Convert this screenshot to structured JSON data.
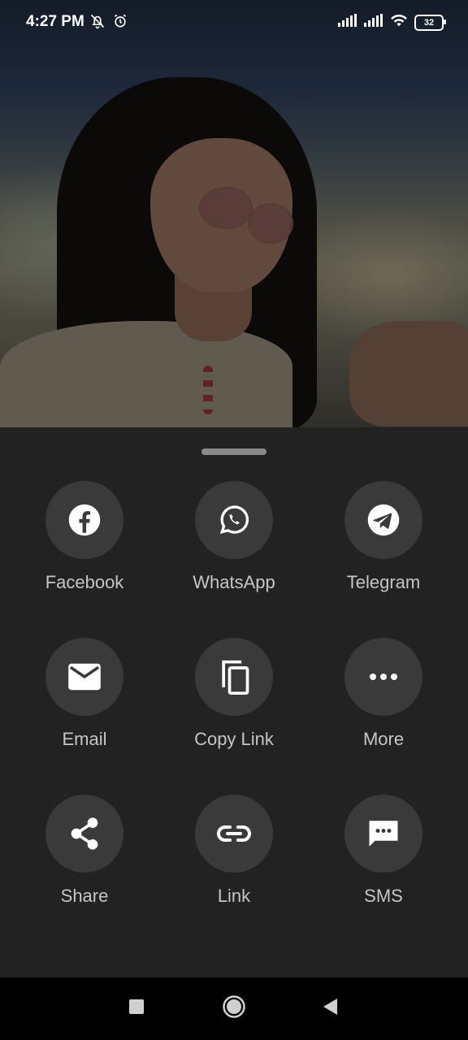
{
  "status_bar": {
    "time": "4:27 PM",
    "battery": "32",
    "icons": [
      "notifications-off-icon",
      "alarm-icon",
      "signal-icon",
      "signal-icon",
      "wifi-icon",
      "battery-icon"
    ]
  },
  "share_sheet": {
    "items": [
      {
        "label": "Facebook",
        "icon": "facebook-icon"
      },
      {
        "label": "WhatsApp",
        "icon": "whatsapp-icon"
      },
      {
        "label": "Telegram",
        "icon": "telegram-icon"
      },
      {
        "label": "Email",
        "icon": "email-icon"
      },
      {
        "label": "Copy Link",
        "icon": "copy-icon"
      },
      {
        "label": "More",
        "icon": "more-icon"
      },
      {
        "label": "Share",
        "icon": "share-icon"
      },
      {
        "label": "Link",
        "icon": "link-icon"
      },
      {
        "label": "SMS",
        "icon": "sms-icon"
      }
    ]
  },
  "nav_bar": {
    "buttons": [
      "recents-icon",
      "home-icon",
      "back-icon"
    ]
  },
  "colors": {
    "sheet_bg": "#222222",
    "icon_circle": "#3a3a3a",
    "label": "#c6c6c6"
  }
}
